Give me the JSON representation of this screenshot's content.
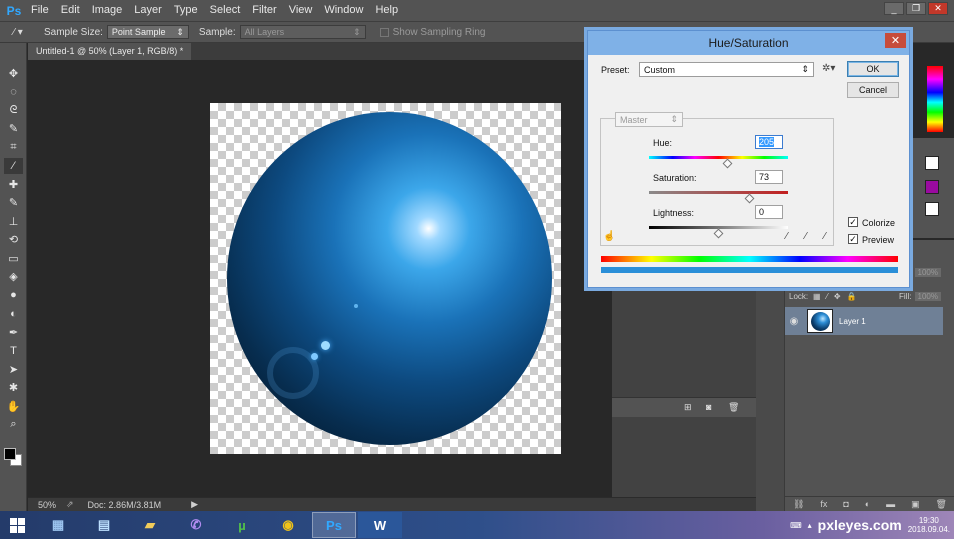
{
  "app": {
    "logo": "Ps"
  },
  "menu": [
    "File",
    "Edit",
    "Image",
    "Layer",
    "Type",
    "Select",
    "Filter",
    "View",
    "Window",
    "Help"
  ],
  "window_controls": {
    "minimize": "_",
    "restore": "❐",
    "close": "✕"
  },
  "options_bar": {
    "sample_size_label": "Sample Size:",
    "sample_size_value": "Point Sample",
    "sample_label": "Sample:",
    "sample_value": "All Layers",
    "show_ring_label": "Show Sampling Ring"
  },
  "document": {
    "tab_title": "Untitled-1 @ 50% (Layer 1, RGB/8) *",
    "zoom": "50%",
    "doc_size": "Doc: 2.86M/3.81M"
  },
  "tools": [
    "move-icon",
    "marquee-icon",
    "lasso-icon",
    "quick-select-icon",
    "crop-icon",
    "eyedropper-icon",
    "healing-icon",
    "brush-icon",
    "stamp-icon",
    "history-brush-icon",
    "eraser-icon",
    "bucket-icon",
    "blur-icon",
    "dodge-icon",
    "pen-icon",
    "type-icon",
    "path-select-icon",
    "shape-icon",
    "hand-icon",
    "zoom-icon"
  ],
  "tool_glyphs": [
    "✥",
    "◌",
    "ᘓ",
    "✎",
    "⌗",
    "⁄",
    "✚",
    "✎",
    "⊥",
    "⟲",
    "▭",
    "◈",
    "●",
    "◐",
    "✒",
    "T",
    "➤",
    "✱",
    "✋",
    "⌕"
  ],
  "layers": {
    "lock_label": "Lock:",
    "fill_label": "Fill:",
    "fill_value": "100%",
    "opacity_value": "100%",
    "layer_name": "Layer 1"
  },
  "dialog": {
    "title": "Hue/Saturation",
    "close": "✕",
    "preset_label": "Preset:",
    "preset_value": "Custom",
    "ok_label": "OK",
    "cancel_label": "Cancel",
    "channel_value": "Master",
    "hue_label": "Hue:",
    "hue_value": "205",
    "hue_level": 0.57,
    "saturation_label": "Saturation:",
    "saturation_value": "73",
    "saturation_level": 0.73,
    "lightness_label": "Lightness:",
    "lightness_value": "0",
    "lightness_level": 0.5,
    "colorize_label": "Colorize",
    "colorize_checked": true,
    "preview_label": "Preview",
    "preview_checked": true
  },
  "taskbar": {
    "apps": [
      "calculator-icon",
      "explorer-icon",
      "folder-icon",
      "viber-icon",
      "utorrent-icon",
      "chrome-icon",
      "photoshop-icon",
      "word-icon"
    ],
    "ps_label": "Ps",
    "word_label": "W",
    "brand": "pxleyes.com",
    "time": "19:30",
    "date": "2018.09.04."
  },
  "colors": {
    "accent": "#31a8ff",
    "dialog_title": "#7fb1e7",
    "selected_layer": "#6f8096"
  }
}
